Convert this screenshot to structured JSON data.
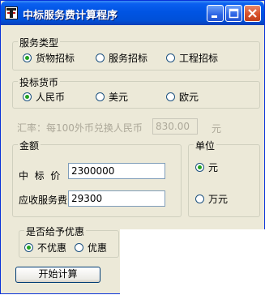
{
  "window": {
    "title": "中标服务费计算程序"
  },
  "service_type": {
    "legend": "服务类型",
    "options": [
      "货物招标",
      "服务招标",
      "工程招标"
    ],
    "selected_index": 0
  },
  "currency": {
    "legend": "投标货币",
    "options": [
      "人民币",
      "美元",
      "欧元"
    ],
    "selected_index": 0
  },
  "exchange": {
    "label": "汇率：每100外币兑换人民币",
    "value": "830.00",
    "unit": "元"
  },
  "amount": {
    "legend": "金额",
    "bid_price_label": "中  标  价",
    "bid_price_value": "2300000",
    "fee_label": "应收服务费",
    "fee_value": "29300"
  },
  "unit": {
    "legend": "单位",
    "options": [
      "元",
      "万元"
    ],
    "selected_index": 0
  },
  "discount": {
    "legend": "是否给予优惠",
    "options": [
      "不优惠",
      "优惠"
    ],
    "selected_index": 0
  },
  "actions": {
    "calculate_label": "开始计算"
  }
}
